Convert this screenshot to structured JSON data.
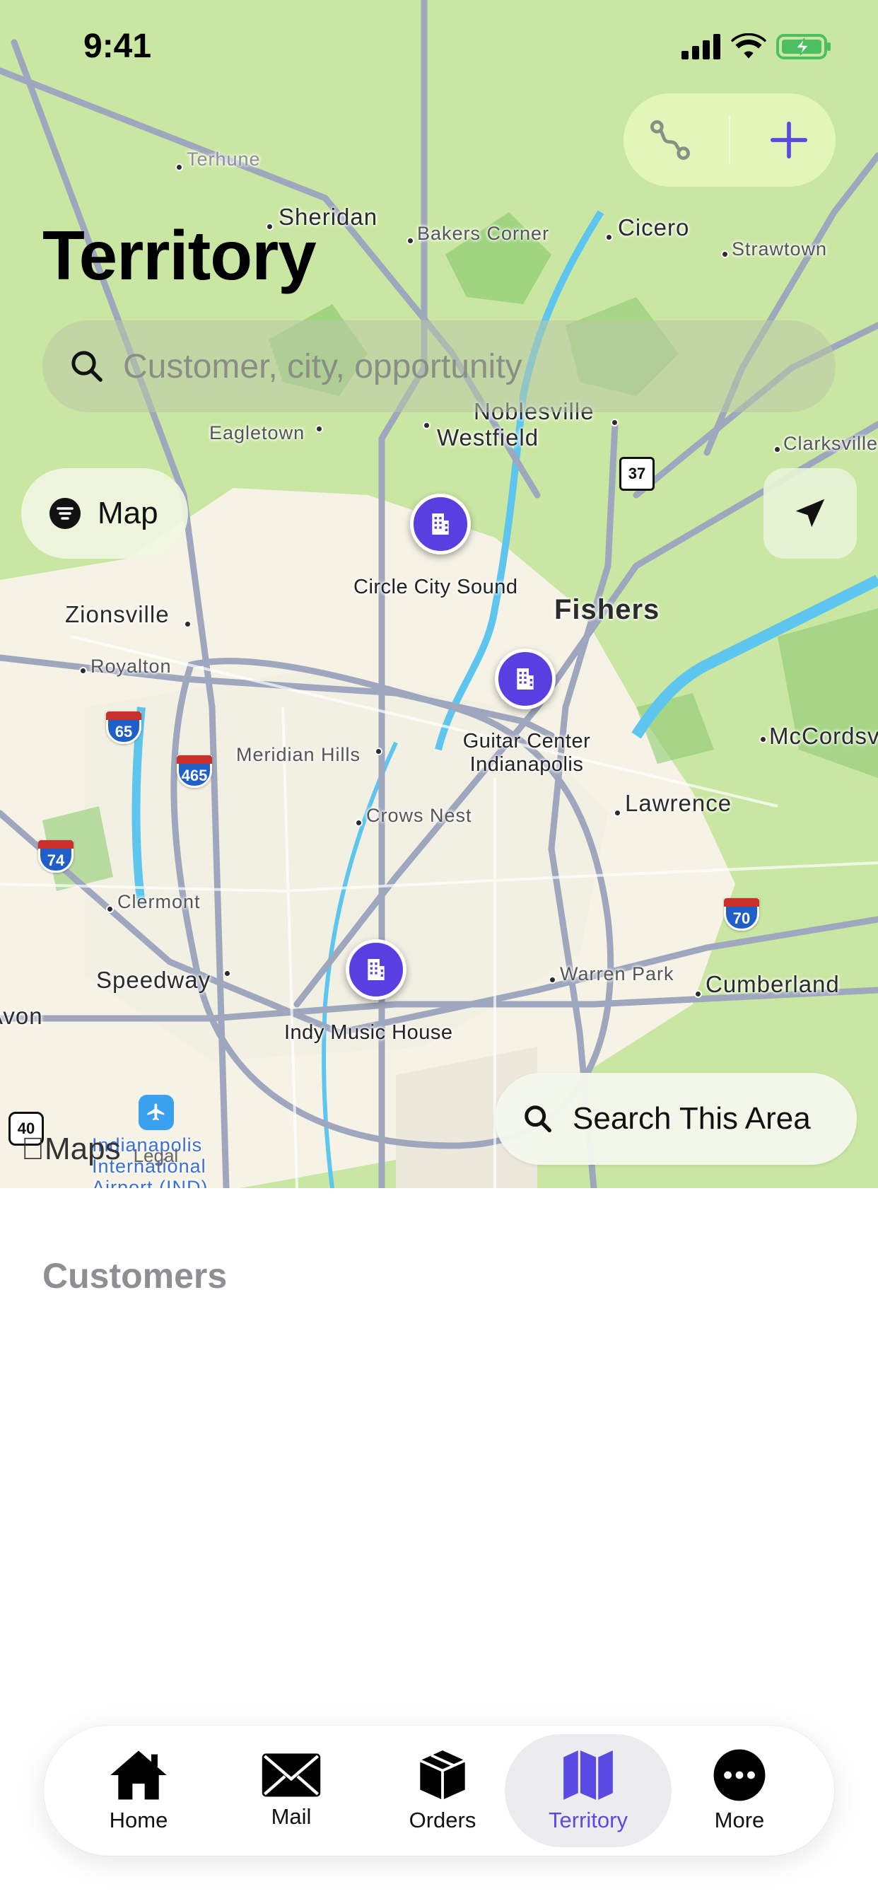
{
  "status_bar": {
    "time": "9:41"
  },
  "header": {
    "title": "Territory"
  },
  "search": {
    "placeholder": "Customer, city, opportunity"
  },
  "map_controls": {
    "map_style_label": "Map",
    "search_area_label": "Search This Area",
    "attribution": "Maps",
    "legal": "Legal"
  },
  "map": {
    "places": [
      "Terhune",
      "Sheridan",
      "Bakers Corner",
      "Cicero",
      "Strawtown",
      "Eagletown",
      "Noblesville",
      "Westfield",
      "Clarksville",
      "Fishers",
      "Zionsville",
      "Royalton",
      "Meridian Hills",
      "McCordsville",
      "Crows Nest",
      "Lawrence",
      "Clermont",
      "Speedway",
      "Warren Park",
      "Cumberland",
      "Avon",
      "Indianapolis International Airport (IND)"
    ],
    "highways": [
      "37",
      "65",
      "465",
      "74",
      "70",
      "40"
    ],
    "pins": [
      {
        "name": "Circle City Sound"
      },
      {
        "name": "Guitar Center Indianapolis"
      },
      {
        "name": "Indy Music House"
      }
    ]
  },
  "content": {
    "section_title": "Customers"
  },
  "tabs": [
    {
      "label": "Home",
      "icon": "house-icon"
    },
    {
      "label": "Mail",
      "icon": "envelope-icon"
    },
    {
      "label": "Orders",
      "icon": "box-icon"
    },
    {
      "label": "Territory",
      "icon": "map-icon",
      "active": true
    },
    {
      "label": "More",
      "icon": "ellipsis-icon"
    }
  ],
  "colors": {
    "accent": "#5a4ae3",
    "pin": "#5a3fe0",
    "map_green": "#c9e7a2"
  }
}
